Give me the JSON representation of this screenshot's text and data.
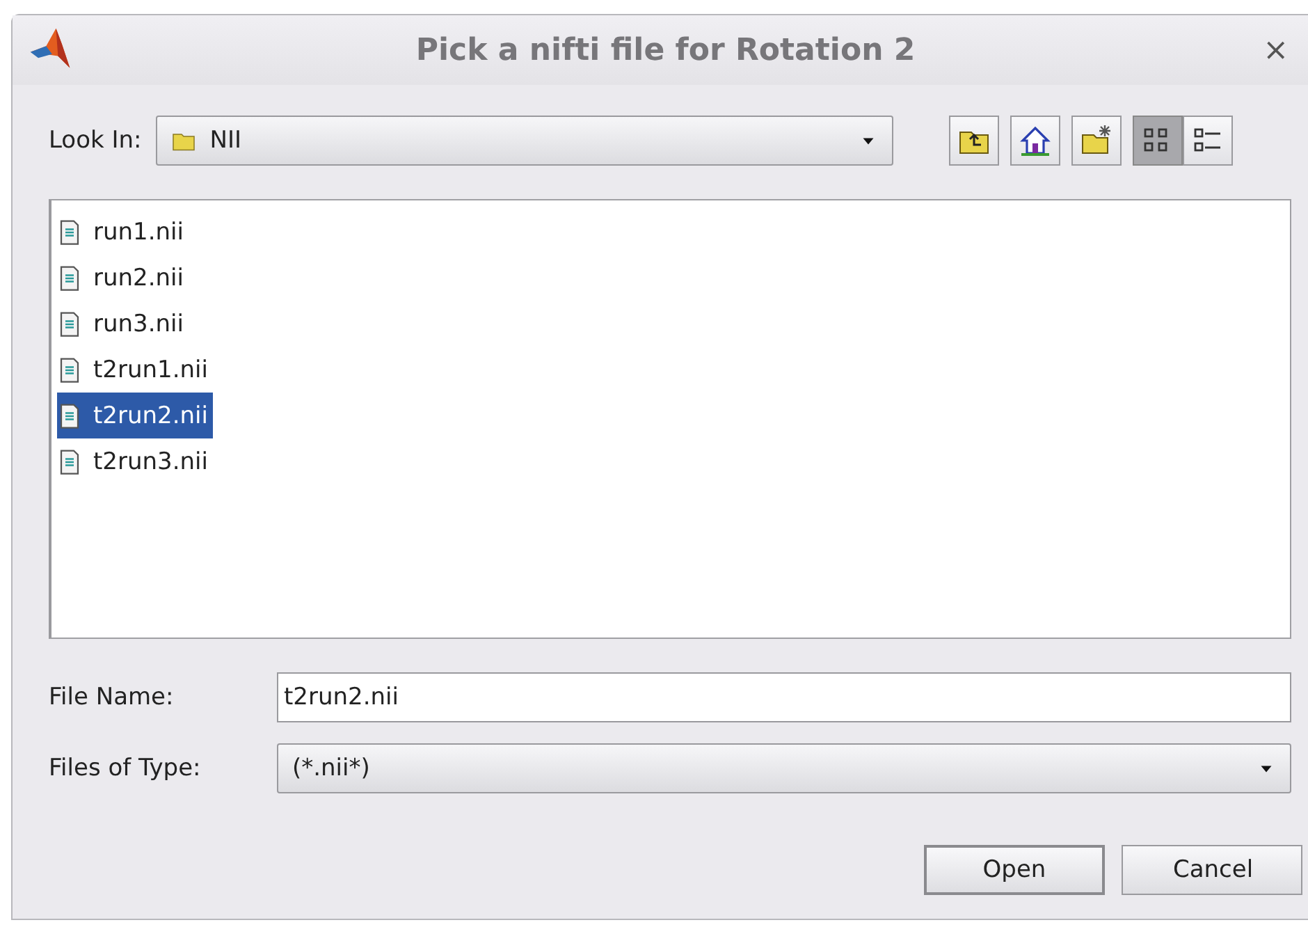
{
  "window": {
    "title": "Pick a nifti file for Rotation 2",
    "close": "×"
  },
  "look_in": {
    "label": "Look In:",
    "value": "NII"
  },
  "toolbar": [
    {
      "kind": "up",
      "selected": false
    },
    {
      "kind": "home",
      "selected": false
    },
    {
      "kind": "new-folder",
      "selected": false
    },
    {
      "kind": "list",
      "selected": true
    },
    {
      "kind": "details",
      "selected": false
    }
  ],
  "files": [
    {
      "name": "run1.nii",
      "selected": false
    },
    {
      "name": "run2.nii",
      "selected": false
    },
    {
      "name": "run3.nii",
      "selected": false
    },
    {
      "name": "t2run1.nii",
      "selected": false
    },
    {
      "name": "t2run2.nii",
      "selected": true
    },
    {
      "name": "t2run3.nii",
      "selected": false
    }
  ],
  "file_name": {
    "label": "File Name:",
    "value": "t2run2.nii"
  },
  "file_type": {
    "label": "Files of Type:",
    "value": "(*.nii*)"
  },
  "buttons": [
    "Open",
    "Cancel"
  ]
}
